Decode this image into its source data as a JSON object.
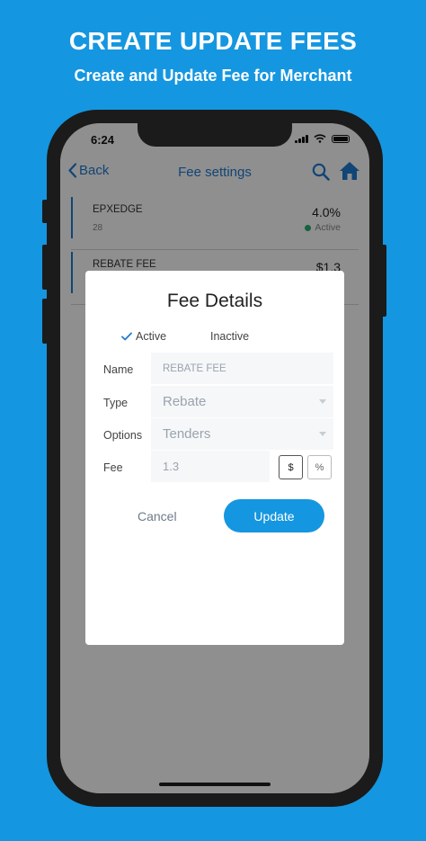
{
  "promo": {
    "title": "CREATE UPDATE FEES",
    "subtitle": "Create and Update Fee for Merchant"
  },
  "status_bar": {
    "time": "6:24"
  },
  "nav": {
    "back_label": "Back",
    "title": "Fee settings",
    "search_icon": "search-icon",
    "home_icon": "home-icon"
  },
  "fees": [
    {
      "name": "EPXEDGE",
      "sub": "28",
      "value": "4.0%",
      "status": "Active"
    },
    {
      "name": "REBATE FEE",
      "value": "$1.3"
    }
  ],
  "modal": {
    "title": "Fee Details",
    "status_options": {
      "active": "Active",
      "inactive": "Inactive",
      "selected": "Active"
    },
    "name_label": "Name",
    "name_value": "REBATE FEE",
    "type_label": "Type",
    "type_value": "Rebate",
    "options_label": "Options",
    "options_value": "Tenders",
    "fee_label": "Fee",
    "fee_value": "1.3",
    "unit_dollar": "$",
    "unit_percent": "%",
    "selected_unit": "$",
    "cancel_label": "Cancel",
    "update_label": "Update"
  },
  "colors": {
    "brand": "#1596e0",
    "nav_blue": "#1f7bd1",
    "active_green": "#27b06e"
  }
}
